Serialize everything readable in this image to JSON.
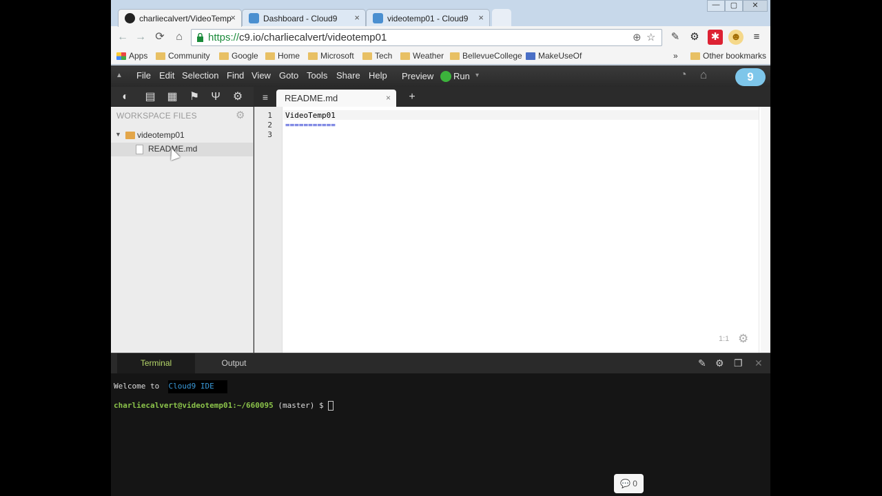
{
  "browser": {
    "tabs": [
      {
        "title": "charliecalvert/VideoTemp",
        "icon": "github-icon",
        "active": true
      },
      {
        "title": "Dashboard - Cloud9",
        "icon": "cloud9-icon",
        "active": false
      },
      {
        "title": "videotemp01 - Cloud9",
        "icon": "cloud9-icon",
        "active": false
      }
    ],
    "tab_close": "×",
    "window_controls": {
      "minimize": "—",
      "maximize": "▢",
      "close": "✕"
    },
    "nav": {
      "back": "←",
      "forward": "→",
      "reload": "⟳",
      "home": "⌂"
    },
    "url": {
      "scheme": "https://",
      "rest": "c9.io/charliecalvert/videotemp01"
    },
    "omnibox_icons": {
      "zoom": "⊕",
      "star": "☆"
    },
    "extensions": [
      "✎",
      "⚙",
      "✱",
      "☻",
      "≡"
    ],
    "bookmarks": [
      "Apps",
      "Community",
      "Google",
      "Home",
      "Microsoft",
      "Tech",
      "Weather",
      "BellevueCollege",
      "MakeUseOf"
    ],
    "bookmarks_overflow": "»",
    "other_bookmarks": "Other bookmarks"
  },
  "ide": {
    "menu": [
      "File",
      "Edit",
      "Selection",
      "Find",
      "View",
      "Goto",
      "Tools",
      "Share",
      "Help"
    ],
    "preview_label": "Preview",
    "run_label": "Run",
    "run_caret": "▾",
    "logo_text": "9",
    "sidebar_tools": [
      "◐",
      "▤",
      "▦",
      "⚑",
      "Ψ",
      "⚙"
    ],
    "editor_menu_icon": "≡",
    "editor_tab": {
      "label": "README.md",
      "close": "×"
    },
    "new_tab_label": "+",
    "workspace_header": "WORKSPACE FILES",
    "tree": {
      "folder": "videotemp01",
      "file": "README.md"
    },
    "gutter": [
      "1",
      "2",
      "3"
    ],
    "code": [
      "VideoTemp01",
      "==========="
    ],
    "cursor_position": "1:1",
    "settings_gear": "⚙",
    "console": {
      "tabs": [
        "Terminal",
        "Output"
      ],
      "toolbar_icons": [
        "✎",
        "⚙",
        "❐",
        "✕"
      ],
      "welcome_prefix": "Welcome to  ",
      "welcome_brand": "Cloud9",
      "welcome_suffix": " IDE",
      "prompt_user": "charliecalvert@videotemp01",
      "prompt_path": ":~/660095",
      "prompt_branch": " (master) $ "
    },
    "chat": {
      "count": "0"
    }
  },
  "colors": {
    "accent_green": "#3cb33c",
    "cloud9_blue": "#7ec6ea",
    "terminal_green": "#b7d86a"
  }
}
